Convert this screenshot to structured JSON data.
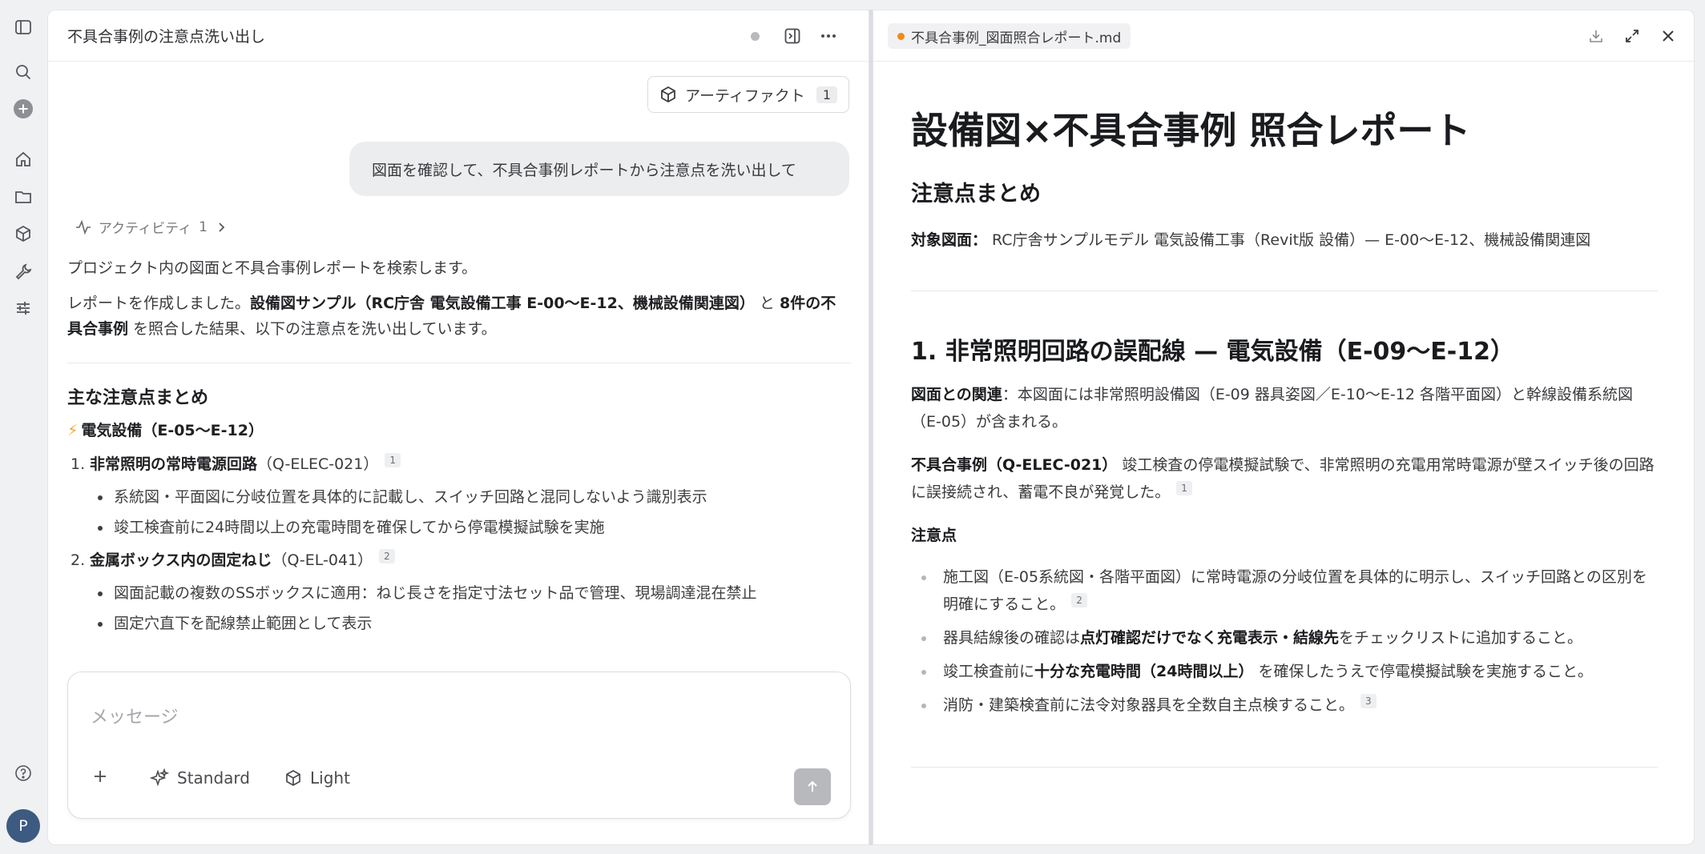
{
  "sidebar": {
    "icons": [
      "sidebar-toggle-icon",
      "search-icon",
      "new-chat-icon",
      "home-icon",
      "folder-icon",
      "cube-icon",
      "wrench-icon",
      "sliders-icon",
      "help-icon"
    ],
    "avatar_letter": "P"
  },
  "chat": {
    "title": "不具合事例の注意点洗い出し",
    "artifact_button": {
      "label": "アーティファクト",
      "count": "1"
    },
    "user_message": "図面を確認して、不具合事例レポートから注意点を洗い出して",
    "activity": {
      "label": "アクティビティ",
      "count": "1"
    },
    "assistant": {
      "p1": "プロジェクト内の図面と不具合事例レポートを検索します。",
      "p2_pre": "レポートを作成しました。",
      "p2_bold1": "設備図サンプル（RC庁舎 電気設備工事 E-00〜E-12、機械設備関連図）",
      "p2_mid": " と ",
      "p2_bold2": "8件の不具合事例",
      "p2_post": " を照合した結果、以下の注意点を洗い出しています。",
      "heading": "主な注意点まとめ",
      "subheading": "電気設備（E-05〜E-12）",
      "items": [
        {
          "num": "1.",
          "title": "非常照明の常時電源回路",
          "code": "（Q-ELEC-021）",
          "ref": "1",
          "bullets": [
            "系統図・平面図に分岐位置を具体的に記載し、スイッチ回路と混同しないよう識別表示",
            "竣工検査前に24時間以上の充電時間を確保してから停電模擬試験を実施"
          ]
        },
        {
          "num": "2.",
          "title": "金属ボックス内の固定ねじ",
          "code": "（Q-EL-041）",
          "ref": "2",
          "bullets": [
            "図面記載の複数のSSボックスに適用：ねじ長さを指定寸法セット品で管理、現場調達混在禁止",
            "固定穴直下を配線禁止範囲として表示"
          ]
        }
      ]
    },
    "composer": {
      "placeholder": "メッセージ",
      "mode1": "Standard",
      "mode2": "Light"
    }
  },
  "document": {
    "tab_title": "不具合事例_図面照合レポート.md",
    "h1": "設備図×不具合事例 照合レポート",
    "summary_heading": "注意点まとめ",
    "target_label": "対象図面：",
    "target_value": " RC庁舎サンプルモデル 電気設備工事（Revit版 設備）— E-00〜E-12、機械設備関連図",
    "section1": {
      "heading": "1. 非常照明回路の誤配線 — 電気設備（E-09〜E-12）",
      "relation_label": "図面との関連",
      "relation_text": "：本図面には非常照明設備図（E-09 器具姿図／E-10〜E-12 各階平面図）と幹線設備系統図（E-05）が含まれる。",
      "case_label": "不具合事例（Q-ELEC-021）",
      "case_text": " 竣工検査の停電模擬試験で、非常照明の充電用常時電源が壁スイッチ後の回路に誤接続され、蓄電不良が発覚した。",
      "case_ref": "1",
      "notes_label": "注意点",
      "bullet1": "施工図（E-05系統図・各階平面図）に常時電源の分岐位置を具体的に明示し、スイッチ回路との区別を明確にすること。",
      "bullet1_ref": "2",
      "bullet2_pre": "器具結線後の確認は",
      "bullet2_bold": "点灯確認だけでなく充電表示・結線先",
      "bullet2_post": "をチェックリストに追加すること。",
      "bullet3_pre": "竣工検査前に",
      "bullet3_bold": "十分な充電時間（24時間以上）",
      "bullet3_post": " を確保したうえで停電模擬試験を実施すること。",
      "bullet4": "消防・建築検査前に法令対象器具を全数自主点検すること。",
      "bullet4_ref": "3"
    }
  }
}
